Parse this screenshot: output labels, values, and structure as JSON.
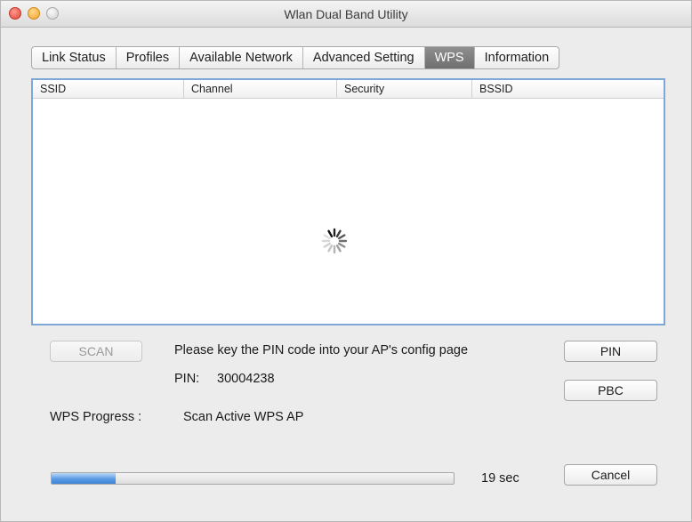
{
  "window": {
    "title": "Wlan Dual Band Utility"
  },
  "tabs": [
    {
      "label": "Link Status",
      "active": false
    },
    {
      "label": "Profiles",
      "active": false
    },
    {
      "label": "Available Network",
      "active": false
    },
    {
      "label": "Advanced Setting",
      "active": false
    },
    {
      "label": "WPS",
      "active": true
    },
    {
      "label": "Information",
      "active": false
    }
  ],
  "ap_table": {
    "columns": [
      "SSID",
      "Channel",
      "Security",
      "BSSID"
    ],
    "rows": [],
    "loading_icon": "spinner-icon"
  },
  "wps": {
    "scan_label": "SCAN",
    "scan_enabled": false,
    "instruction": "Please key the PIN code into your AP's config page",
    "pin_label": "PIN:",
    "pin_value": "30004238",
    "pin_button": "PIN",
    "pbc_button": "PBC",
    "progress_label": "WPS Progress :",
    "progress_status": "Scan Active WPS AP",
    "progress_fraction": 0.16,
    "time_remaining": "19 sec",
    "cancel_button": "Cancel"
  },
  "colors": {
    "active_tab": "#7d7d7d",
    "table_focus_border": "#7ea7d8",
    "progress_fill": "#4a8fdf"
  }
}
